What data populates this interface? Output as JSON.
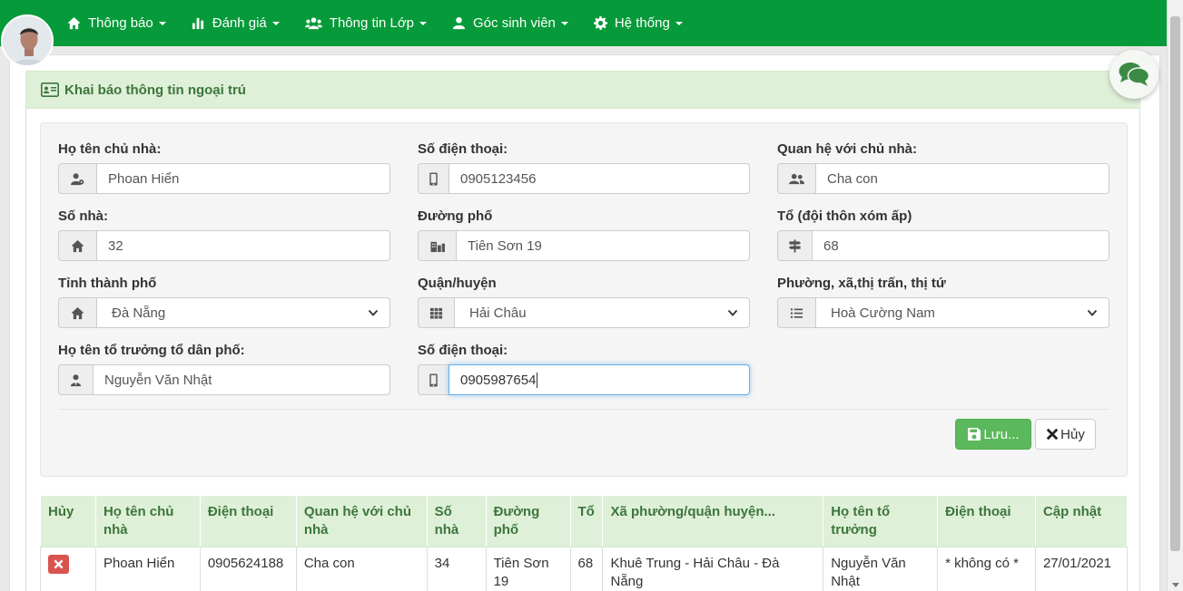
{
  "nav": {
    "items": [
      {
        "label": "Thông báo",
        "icon": "home-icon"
      },
      {
        "label": "Đánh giá",
        "icon": "bar-chart-icon"
      },
      {
        "label": "Thông tin Lớp",
        "icon": "users-icon"
      },
      {
        "label": "Góc sinh viên",
        "icon": "user-icon"
      },
      {
        "label": "Hệ thống",
        "icon": "gear-icon"
      }
    ]
  },
  "panel": {
    "title": "Khai báo thông tin ngoại trú"
  },
  "form": {
    "owner_name": {
      "label": "Họ tên chủ nhà:",
      "value": "Phoan Hiển"
    },
    "phone": {
      "label": "Số điện thoại:",
      "value": "0905123456"
    },
    "relation": {
      "label": "Quan hệ với chủ nhà:",
      "value": "Cha con"
    },
    "house_no": {
      "label": "Số nhà:",
      "value": "32"
    },
    "street": {
      "label": "Đường phố",
      "value": "Tiên Sơn 19"
    },
    "group": {
      "label": "Tổ (đội thôn xóm ấp)",
      "value": "68"
    },
    "province": {
      "label": "Tỉnh thành phố",
      "value": "Đà Nẵng"
    },
    "district": {
      "label": "Quận/huyện",
      "value": "Hải Châu"
    },
    "ward": {
      "label": "Phường, xã,thị trấn, thị tứ",
      "value": "Hoà Cường Nam"
    },
    "leader_name": {
      "label": "Họ tên tổ trưởng tổ dân phố:",
      "value": "Nguyễn Văn Nhật"
    },
    "leader_phone": {
      "label": "Số điện thoại:",
      "value": "0905987654"
    }
  },
  "buttons": {
    "save": "Lưu...",
    "cancel": "Hủy"
  },
  "table": {
    "headers": [
      "Hủy",
      "Họ tên chủ nhà",
      "Điện thoại",
      "Quan hệ với chủ nhà",
      "Số nhà",
      "Đường phố",
      "Tổ",
      "Xã phường/quận huyện...",
      "Họ tên tổ trưởng",
      "Điện thoại",
      "Cập nhật"
    ],
    "rows": [
      {
        "owner": "Phoan Hiển",
        "phone": "0905624188",
        "relation": "Cha con",
        "house_no": "34",
        "street": "Tiên Sơn 19",
        "group": "68",
        "address": "Khuê Trung - Hải Châu - Đà Nẵng",
        "leader": "Nguyễn Văn Nhật",
        "leader_phone": "* không có *",
        "updated": "27/01/2021"
      }
    ]
  },
  "colors": {
    "navbar": "#079a3a",
    "heading_bg": "#dff0d8",
    "heading_text": "#3c763d",
    "save": "#5cb85c",
    "delete": "#d9534f"
  }
}
